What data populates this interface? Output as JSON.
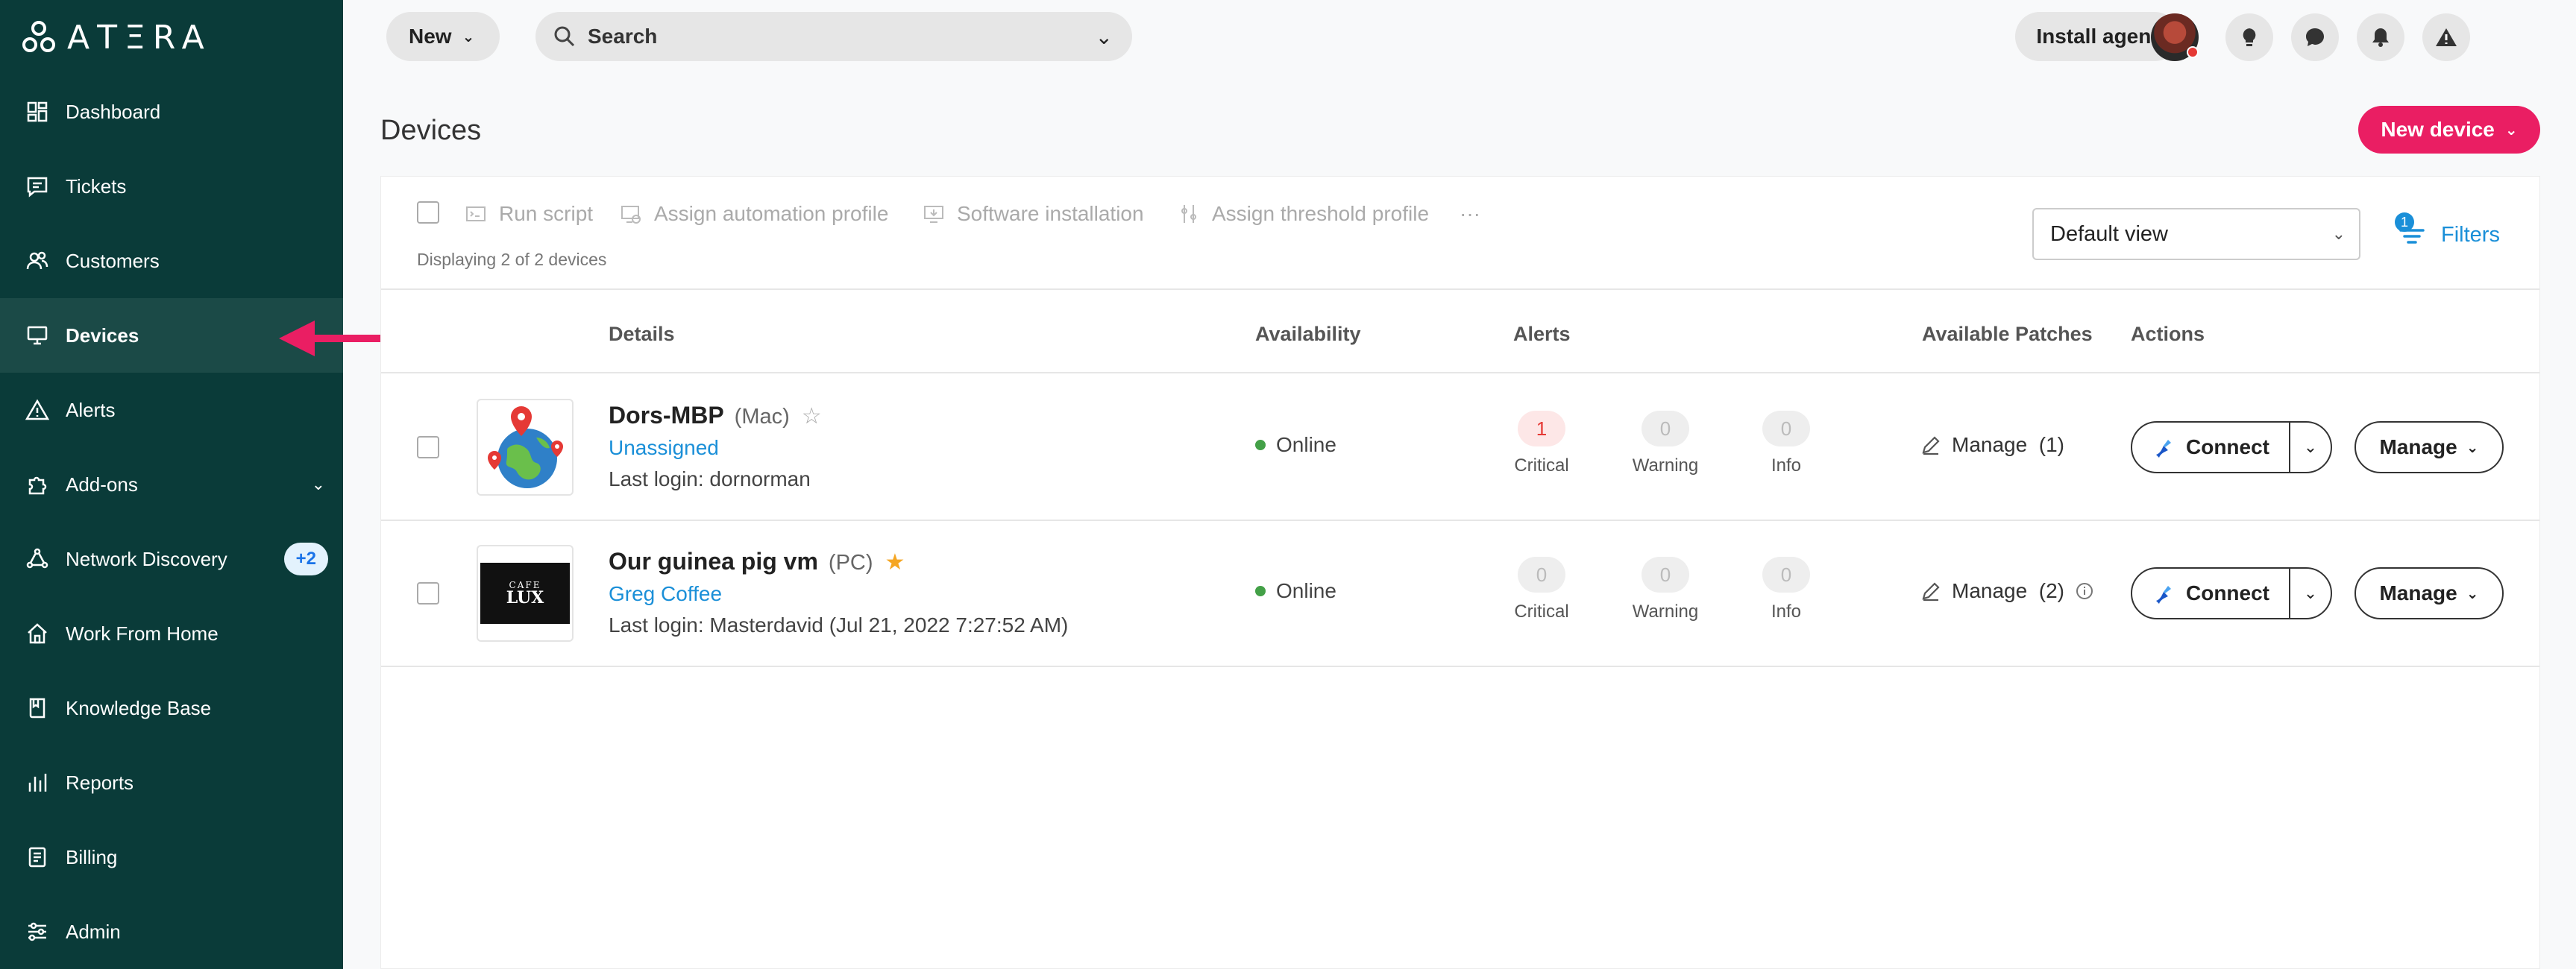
{
  "sidebar": {
    "logo_text": "AΤΞRA",
    "items": [
      {
        "label": "Dashboard",
        "icon": "dashboard-icon"
      },
      {
        "label": "Tickets",
        "icon": "ticket-icon"
      },
      {
        "label": "Customers",
        "icon": "customers-icon"
      },
      {
        "label": "Devices",
        "icon": "monitor-icon",
        "active": true
      },
      {
        "label": "Alerts",
        "icon": "alert-triangle-icon"
      },
      {
        "label": "Add-ons",
        "icon": "puzzle-icon"
      },
      {
        "label": "Network Discovery",
        "icon": "network-icon",
        "badge": "+2"
      },
      {
        "label": "Work From Home",
        "icon": "home-icon"
      },
      {
        "label": "Knowledge Base",
        "icon": "book-icon"
      },
      {
        "label": "Reports",
        "icon": "bar-chart-icon"
      },
      {
        "label": "Billing",
        "icon": "billing-icon"
      },
      {
        "label": "Admin",
        "icon": "sliders-icon"
      }
    ]
  },
  "topbar": {
    "new_label": "New",
    "search_placeholder": "Search",
    "install_label": "Install agent"
  },
  "page": {
    "title": "Devices",
    "new_device_label": "New device"
  },
  "toolbar": {
    "run_script": "Run script",
    "assign_automation": "Assign automation profile",
    "software_installation": "Software installation",
    "assign_threshold": "Assign threshold profile",
    "more": "···",
    "displaying": "Displaying 2 of 2 devices",
    "view_selected": "Default view",
    "filters_label": "Filters",
    "filters_count": "1"
  },
  "table": {
    "headers": {
      "details": "Details",
      "availability": "Availability",
      "alerts": "Alerts",
      "patches": "Available Patches",
      "actions": "Actions"
    },
    "rows": [
      {
        "name": "Dors-MBP",
        "type": "(Mac)",
        "star": "☆",
        "customer": "Unassigned",
        "last_login": "Last login: dornorman",
        "availability": "Online",
        "critical": "1",
        "warning": "0",
        "info": "0",
        "critical_label": "Critical",
        "warning_label": "Warning",
        "info_label": "Info",
        "patches": "Manage  (1)",
        "connect_label": "Connect",
        "manage_label": "Manage"
      },
      {
        "name": "Our guinea pig vm",
        "type": "(PC)",
        "star": "★",
        "customer": "Greg Coffee",
        "last_login": "Last login: Masterdavid (Jul 21, 2022 7:27:52 AM)",
        "availability": "Online",
        "critical": "0",
        "warning": "0",
        "info": "0",
        "critical_label": "Critical",
        "warning_label": "Warning",
        "info_label": "Info",
        "patches": "Manage  (2)",
        "connect_label": "Connect",
        "manage_label": "Manage"
      }
    ]
  },
  "thumb_text": {
    "line1": "CAFE",
    "line2": "LUX"
  },
  "colors": {
    "sidebar_bg": "#0a3b39",
    "accent_pink": "#ea1e63",
    "link_blue": "#1a8fd8",
    "online_green": "#43a047",
    "star_gold": "#f5a623"
  }
}
